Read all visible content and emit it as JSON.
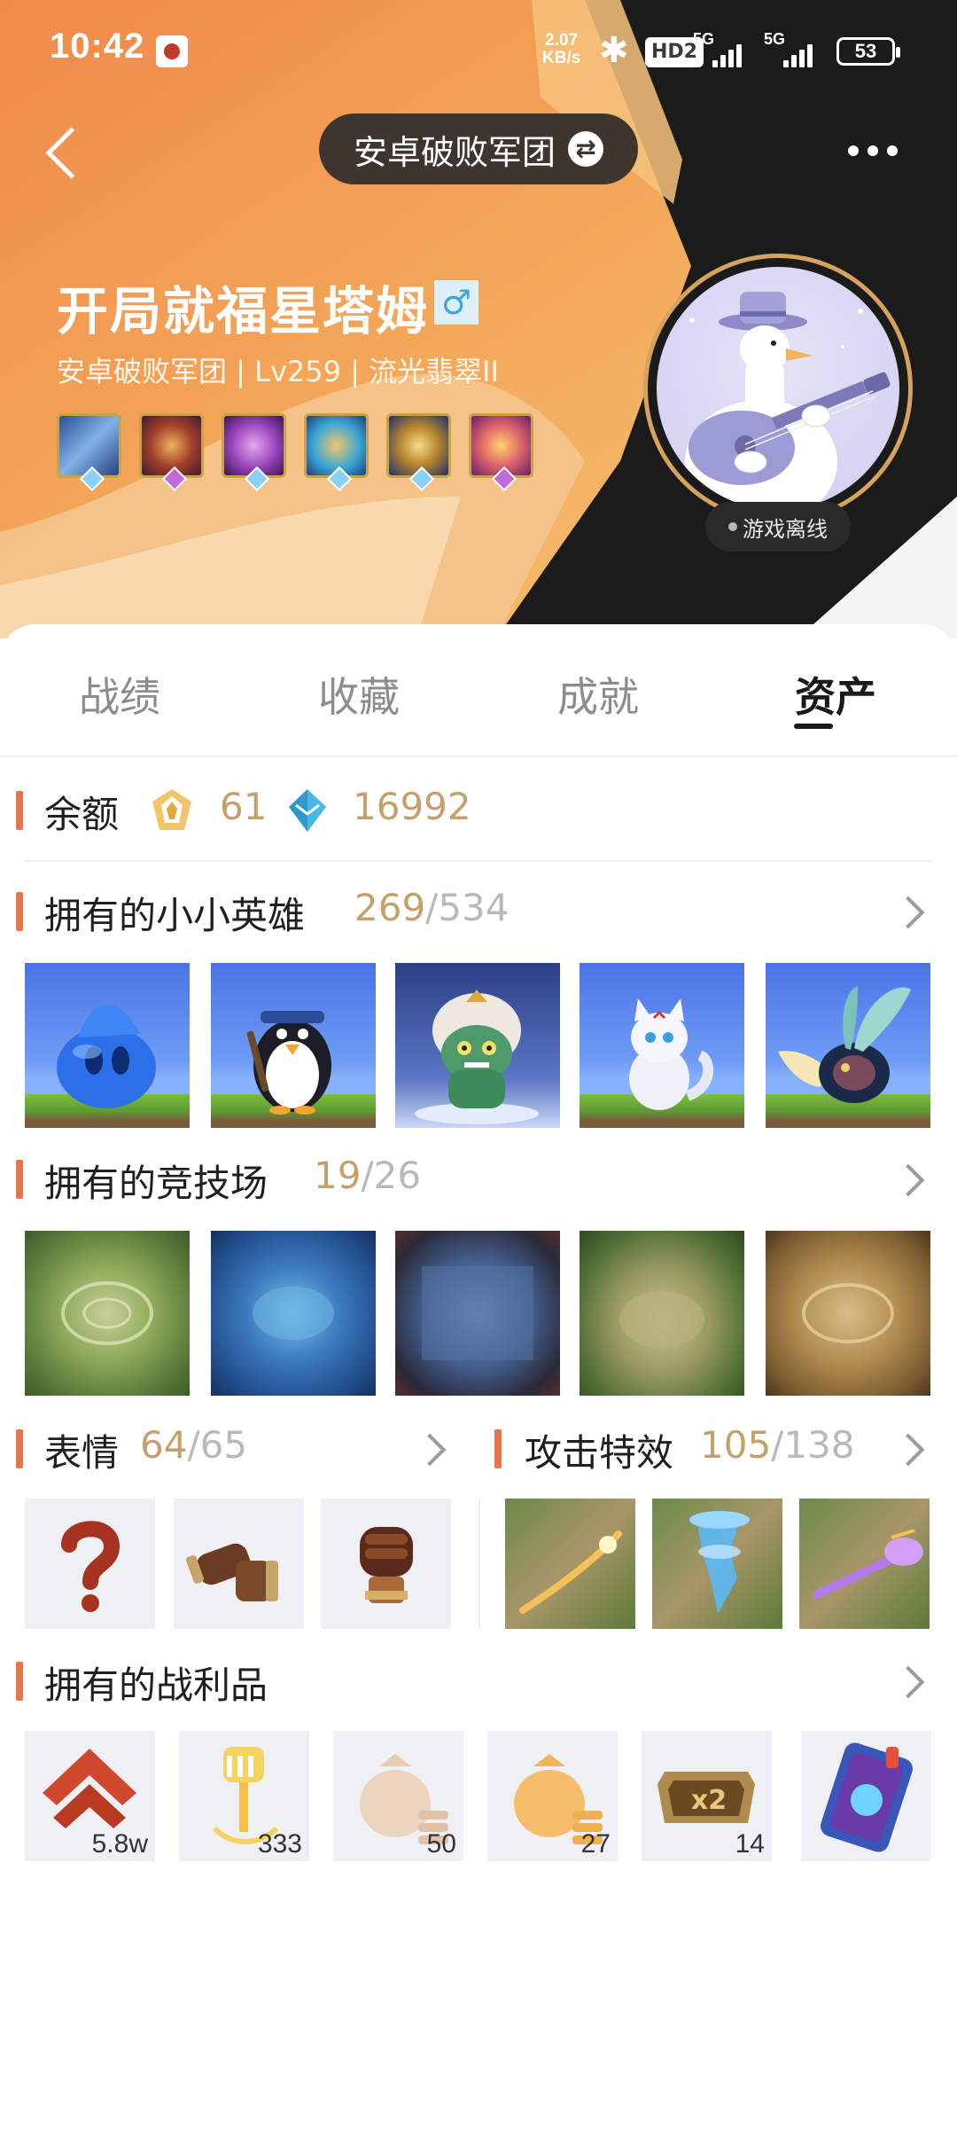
{
  "status_bar": {
    "time": "10:42",
    "net_speed_value": "2.07",
    "net_speed_unit": "KB/s",
    "hd_label": "HD2",
    "signal1": "5G",
    "signal2": "5G",
    "battery": "53"
  },
  "header": {
    "team_name": "安卓破败军团",
    "player_name": "开局就福星塔姆",
    "gender_symbol": "♂",
    "subtitle": "安卓破败军团 | Lv259 | 流光翡翠II",
    "online_status": "游戏离线"
  },
  "tabs": [
    {
      "label": "战绩"
    },
    {
      "label": "收藏"
    },
    {
      "label": "成就"
    },
    {
      "label": "资产"
    }
  ],
  "active_tab": "资产",
  "balance": {
    "title": "余额",
    "currency1": "61",
    "currency2": "16992"
  },
  "little_legends": {
    "title": "拥有的小小英雄",
    "owned": "269",
    "total": "534"
  },
  "arenas": {
    "title": "拥有的竞技场",
    "owned": "19",
    "total": "26"
  },
  "emotes": {
    "title": "表情",
    "owned": "64",
    "total": "65"
  },
  "attack_effects": {
    "title": "攻击特效",
    "owned": "105",
    "total": "138"
  },
  "loot": {
    "title": "拥有的战利品",
    "items": [
      {
        "count": "5.8w",
        "icon": "red-chevron-token-icon"
      },
      {
        "count": "333",
        "icon": "gold-spatula-icon"
      },
      {
        "count": "50",
        "icon": "beige-coin-bag-icon"
      },
      {
        "count": "27",
        "icon": "orange-coin-bag-icon"
      },
      {
        "count": "14",
        "icon": "x2-booster-icon"
      },
      {
        "count": "",
        "icon": "blue-card-pack-icon"
      }
    ]
  },
  "colors": {
    "accent_bar": "#e8744a",
    "count_gold": "#c3a06c",
    "hero_orange": "#f2a255",
    "hero_dark": "#1b1b1b"
  }
}
